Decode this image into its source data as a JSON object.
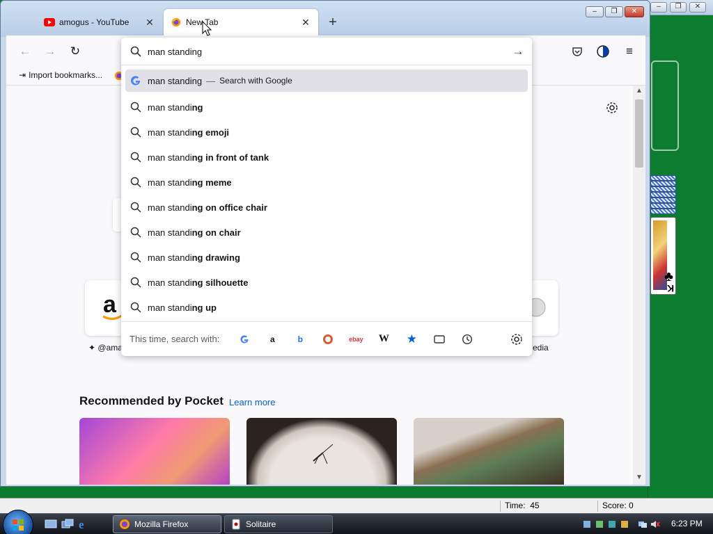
{
  "browser": {
    "tabs": [
      {
        "title": "amogus - YouTube",
        "active": false
      },
      {
        "title": "New Tab",
        "active": true
      }
    ],
    "bookmarks": [
      {
        "label": "Import bookmarks..."
      }
    ]
  },
  "urlbar": {
    "value": "man standing",
    "suggestions": [
      {
        "prefix": "man standing",
        "suffix": "",
        "action": "Search with Google",
        "type": "engine"
      },
      {
        "prefix": "man standi",
        "suffix": "ng",
        "type": "search"
      },
      {
        "prefix": "man standi",
        "suffix": "ng emoji",
        "type": "search"
      },
      {
        "prefix": "man standi",
        "suffix": "ng in front of tank",
        "type": "search"
      },
      {
        "prefix": "man standi",
        "suffix": "ng meme",
        "type": "search"
      },
      {
        "prefix": "man standi",
        "suffix": "ng on office chair",
        "type": "search"
      },
      {
        "prefix": "man standi",
        "suffix": "ng on chair",
        "type": "search"
      },
      {
        "prefix": "man standi",
        "suffix": "ng drawing",
        "type": "search"
      },
      {
        "prefix": "man standi",
        "suffix": "ng silhouette",
        "type": "search"
      },
      {
        "prefix": "man standi",
        "suffix": "ng up",
        "type": "search"
      }
    ],
    "search_with_label": "This time, search with:"
  },
  "newtab": {
    "shortcut_left_label": "@ama",
    "shortcut_right_label": "edia",
    "pocket_title": "Recommended by Pocket",
    "pocket_learn_more": "Learn more"
  },
  "solitaire": {
    "time_label": "Time:",
    "time_value": "45",
    "score_label": "Score: 0"
  },
  "taskbar": {
    "buttons": [
      {
        "label": "Mozilla Firefox",
        "active": true
      },
      {
        "label": "Solitaire",
        "active": false
      }
    ],
    "clock": "6:23 PM"
  },
  "colors": {
    "felt": "#0b7c2d",
    "accent_link": "#0061e0",
    "youtube_red": "#ff0000"
  }
}
